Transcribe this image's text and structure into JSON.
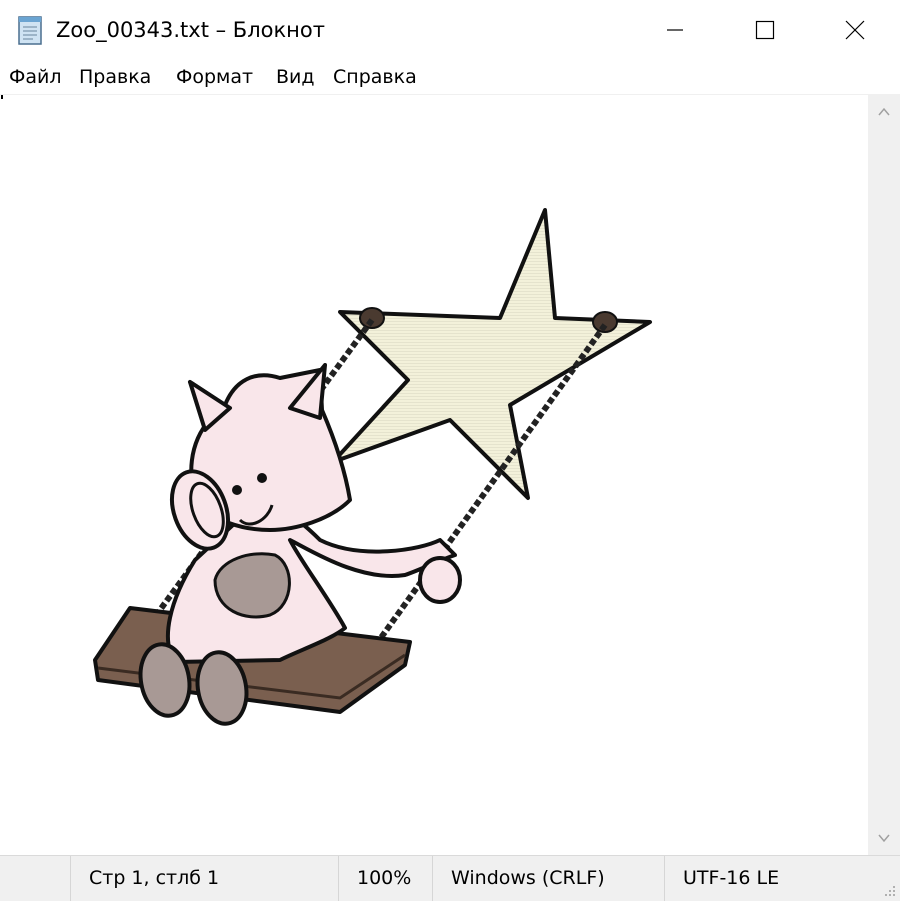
{
  "window": {
    "title": "Zoo_00343.txt – Блокнот",
    "controls": {
      "minimize": "minimize",
      "maximize": "maximize",
      "close": "close"
    }
  },
  "menu": {
    "items": [
      {
        "label": "Файл"
      },
      {
        "label": "Правка"
      },
      {
        "label": "Формат"
      },
      {
        "label": "Вид"
      },
      {
        "label": "Справка"
      }
    ]
  },
  "editor": {
    "content_type": "ascii-art",
    "content_description_icon": "pig-on-star-swing-art"
  },
  "statusbar": {
    "position": "Стр 1, стлб 1",
    "zoom": "100%",
    "line_endings": "Windows (CRLF)",
    "encoding": "UTF-16 LE"
  },
  "colors": {
    "pig_body": "#f9e6ea",
    "star_fill": "#f3f1da",
    "wood": "#7a5f4f",
    "belly": "#a89995",
    "outline": "#111111"
  }
}
